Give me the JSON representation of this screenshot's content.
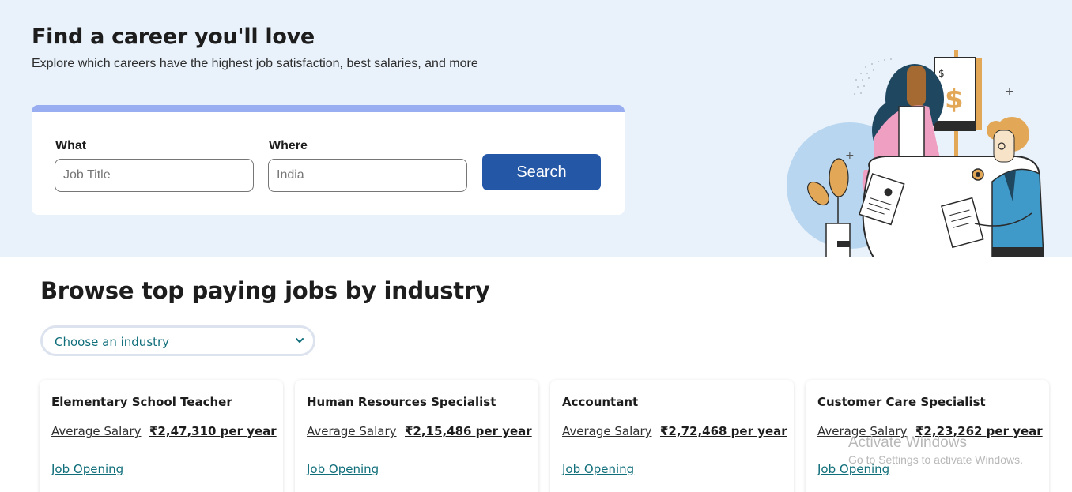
{
  "hero": {
    "title": "Find a career you'll love",
    "subtitle": "Explore which careers have the highest job satisfaction, best salaries, and more"
  },
  "search": {
    "what_label": "What",
    "what_placeholder": "Job Title",
    "where_label": "Where",
    "where_placeholder": "India",
    "button_label": "Search"
  },
  "browse": {
    "title": "Browse top paying jobs by industry",
    "industry_select": "Choose an industry"
  },
  "jobs": [
    {
      "title": "Elementary School Teacher",
      "salary_label": "Average Salary",
      "salary": "₹2,47,310 per year",
      "link": "Job Opening"
    },
    {
      "title": "Human Resources Specialist",
      "salary_label": "Average Salary",
      "salary": "₹2,15,486 per year",
      "link": "Job Opening"
    },
    {
      "title": "Accountant",
      "salary_label": "Average Salary",
      "salary": "₹2,72,468 per year",
      "link": "Job Opening"
    },
    {
      "title": "Customer Care Specialist",
      "salary_label": "Average Salary",
      "salary": "₹2,23,262 per year",
      "link": "Job Opening"
    }
  ],
  "watermark": {
    "line1": "Activate Windows",
    "line2": "Go to Settings to activate Windows."
  },
  "colors": {
    "hero_bg": "#e9f2fb",
    "primary_button": "#2557a7",
    "link": "#0f6e7a",
    "card_accent": "#98aef0"
  },
  "icons": [
    "chevron-down-icon",
    "career-illustration"
  ]
}
